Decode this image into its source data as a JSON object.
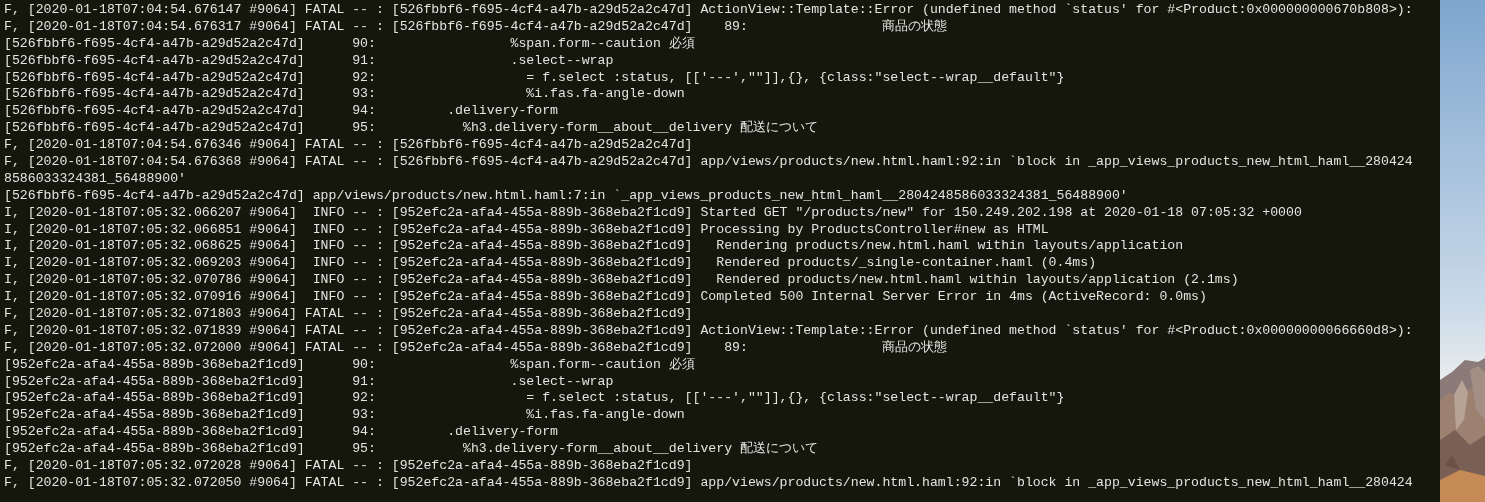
{
  "terminal": {
    "lines": [
      "F, [2020-01-18T07:04:54.676147 #9064] FATAL -- : [526fbbf6-f695-4cf4-a47b-a29d52a2c47d] ActionView::Template::Error (undefined method `status' for #<Product:0x000000000670b808>):",
      "F, [2020-01-18T07:04:54.676317 #9064] FATAL -- : [526fbbf6-f695-4cf4-a47b-a29d52a2c47d]    89:                 商品の状態",
      "[526fbbf6-f695-4cf4-a47b-a29d52a2c47d]      90:                 %span.form--caution 必須",
      "[526fbbf6-f695-4cf4-a47b-a29d52a2c47d]      91:                 .select--wrap",
      "[526fbbf6-f695-4cf4-a47b-a29d52a2c47d]      92:                   = f.select :status, [['---',\"\"]],{}, {class:\"select--wrap__default\"}",
      "[526fbbf6-f695-4cf4-a47b-a29d52a2c47d]      93:                   %i.fas.fa-angle-down",
      "[526fbbf6-f695-4cf4-a47b-a29d52a2c47d]      94:         .delivery-form",
      "[526fbbf6-f695-4cf4-a47b-a29d52a2c47d]      95:           %h3.delivery-form__about__delivery 配送について",
      "F, [2020-01-18T07:04:54.676346 #9064] FATAL -- : [526fbbf6-f695-4cf4-a47b-a29d52a2c47d]",
      "F, [2020-01-18T07:04:54.676368 #9064] FATAL -- : [526fbbf6-f695-4cf4-a47b-a29d52a2c47d] app/views/products/new.html.haml:92:in `block in _app_views_products_new_html_haml__280424",
      "8586033324381_56488900'",
      "[526fbbf6-f695-4cf4-a47b-a29d52a2c47d] app/views/products/new.html.haml:7:in `_app_views_products_new_html_haml__2804248586033324381_56488900'",
      "I, [2020-01-18T07:05:32.066207 #9064]  INFO -- : [952efc2a-afa4-455a-889b-368eba2f1cd9] Started GET \"/products/new\" for 150.249.202.198 at 2020-01-18 07:05:32 +0000",
      "I, [2020-01-18T07:05:32.066851 #9064]  INFO -- : [952efc2a-afa4-455a-889b-368eba2f1cd9] Processing by ProductsController#new as HTML",
      "I, [2020-01-18T07:05:32.068625 #9064]  INFO -- : [952efc2a-afa4-455a-889b-368eba2f1cd9]   Rendering products/new.html.haml within layouts/application",
      "I, [2020-01-18T07:05:32.069203 #9064]  INFO -- : [952efc2a-afa4-455a-889b-368eba2f1cd9]   Rendered products/_single-container.haml (0.4ms)",
      "I, [2020-01-18T07:05:32.070786 #9064]  INFO -- : [952efc2a-afa4-455a-889b-368eba2f1cd9]   Rendered products/new.html.haml within layouts/application (2.1ms)",
      "I, [2020-01-18T07:05:32.070916 #9064]  INFO -- : [952efc2a-afa4-455a-889b-368eba2f1cd9] Completed 500 Internal Server Error in 4ms (ActiveRecord: 0.0ms)",
      "F, [2020-01-18T07:05:32.071803 #9064] FATAL -- : [952efc2a-afa4-455a-889b-368eba2f1cd9]",
      "F, [2020-01-18T07:05:32.071839 #9064] FATAL -- : [952efc2a-afa4-455a-889b-368eba2f1cd9] ActionView::Template::Error (undefined method `status' for #<Product:0x00000000066660d8>):",
      "F, [2020-01-18T07:05:32.072000 #9064] FATAL -- : [952efc2a-afa4-455a-889b-368eba2f1cd9]    89:                 商品の状態",
      "[952efc2a-afa4-455a-889b-368eba2f1cd9]      90:                 %span.form--caution 必須",
      "[952efc2a-afa4-455a-889b-368eba2f1cd9]      91:                 .select--wrap",
      "[952efc2a-afa4-455a-889b-368eba2f1cd9]      92:                   = f.select :status, [['---',\"\"]],{}, {class:\"select--wrap__default\"}",
      "[952efc2a-afa4-455a-889b-368eba2f1cd9]      93:                   %i.fas.fa-angle-down",
      "[952efc2a-afa4-455a-889b-368eba2f1cd9]      94:         .delivery-form",
      "[952efc2a-afa4-455a-889b-368eba2f1cd9]      95:           %h3.delivery-form__about__delivery 配送について",
      "F, [2020-01-18T07:05:32.072028 #9064] FATAL -- : [952efc2a-afa4-455a-889b-368eba2f1cd9]",
      "F, [2020-01-18T07:05:32.072050 #9064] FATAL -- : [952efc2a-afa4-455a-889b-368eba2f1cd9] app/views/products/new.html.haml:92:in `block in _app_views_products_new_html_haml__280424"
    ]
  }
}
